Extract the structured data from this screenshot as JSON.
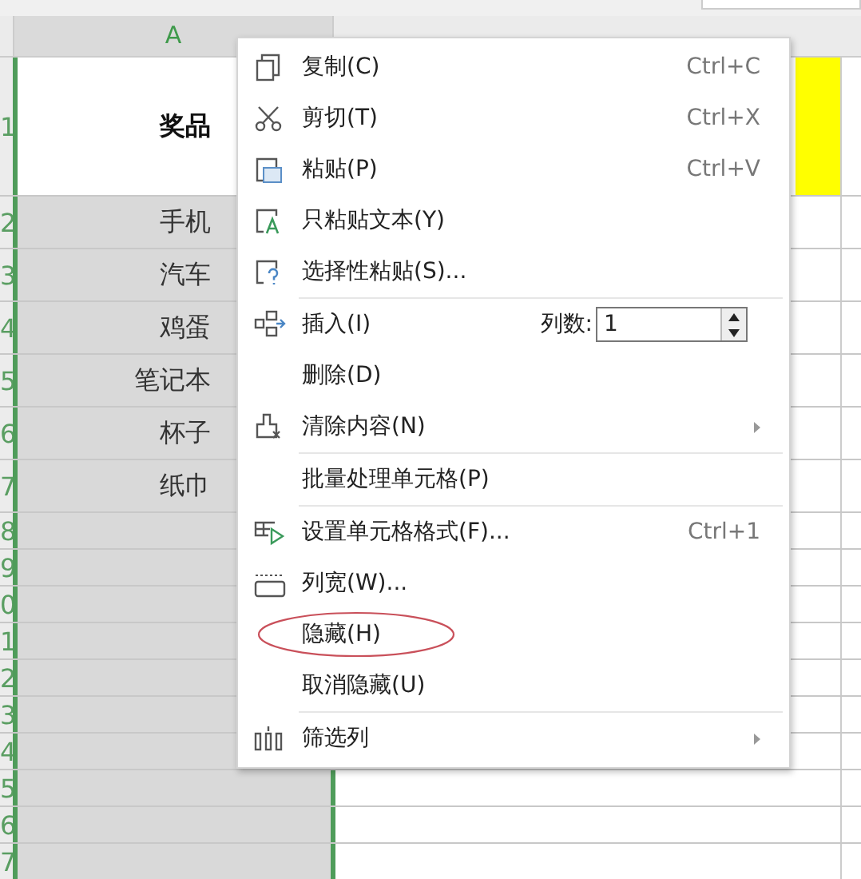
{
  "sheet": {
    "column_header": "A",
    "header_row_number": "1",
    "header_cell": "奖品",
    "rows": [
      {
        "number": "2",
        "value": "手机"
      },
      {
        "number": "3",
        "value": "汽车"
      },
      {
        "number": "4",
        "value": "鸡蛋"
      },
      {
        "number": "5",
        "value": "笔记本"
      },
      {
        "number": "6",
        "value": "杯子"
      },
      {
        "number": "7",
        "value": "纸巾"
      },
      {
        "number": "8"
      },
      {
        "number": "9"
      },
      {
        "number": "0"
      },
      {
        "number": "1"
      },
      {
        "number": "2"
      },
      {
        "number": "3"
      },
      {
        "number": "4"
      },
      {
        "number": "5"
      },
      {
        "number": "6"
      },
      {
        "number": "7"
      }
    ]
  },
  "context_menu": {
    "items": [
      {
        "kind": "command",
        "label": "复制(C)",
        "shortcut": "Ctrl+C",
        "submenu": false,
        "circled": false
      },
      {
        "kind": "command",
        "label": "剪切(T)",
        "shortcut": "Ctrl+X",
        "submenu": false,
        "circled": false
      },
      {
        "kind": "command",
        "label": "粘贴(P)",
        "shortcut": "Ctrl+V",
        "submenu": false,
        "circled": false
      },
      {
        "kind": "command",
        "label": "只粘贴文本(Y)",
        "submenu": false,
        "circled": false
      },
      {
        "kind": "command",
        "label": "选择性粘贴(S)...",
        "submenu": false,
        "circled": false
      },
      {
        "kind": "separator"
      },
      {
        "kind": "command",
        "label": "插入(I)",
        "count_label": "列数:",
        "count_value": "1",
        "submenu": false,
        "circled": false
      },
      {
        "kind": "command",
        "label": "删除(D)",
        "submenu": false,
        "circled": false
      },
      {
        "kind": "command",
        "label": "清除内容(N)",
        "submenu": true,
        "circled": false
      },
      {
        "kind": "separator"
      },
      {
        "kind": "command",
        "label": "批量处理单元格(P)",
        "submenu": false,
        "circled": false
      },
      {
        "kind": "separator"
      },
      {
        "kind": "command",
        "label": "设置单元格格式(F)...",
        "shortcut": "Ctrl+1",
        "submenu": false,
        "circled": false
      },
      {
        "kind": "command",
        "label": "列宽(W)...",
        "submenu": false,
        "circled": false
      },
      {
        "kind": "command",
        "label": "隐藏(H)",
        "submenu": false,
        "circled": true
      },
      {
        "kind": "command",
        "label": "取消隐藏(U)",
        "submenu": false,
        "circled": false
      },
      {
        "kind": "separator"
      },
      {
        "kind": "command",
        "label": "筛选列",
        "submenu": true,
        "circled": false
      }
    ]
  }
}
